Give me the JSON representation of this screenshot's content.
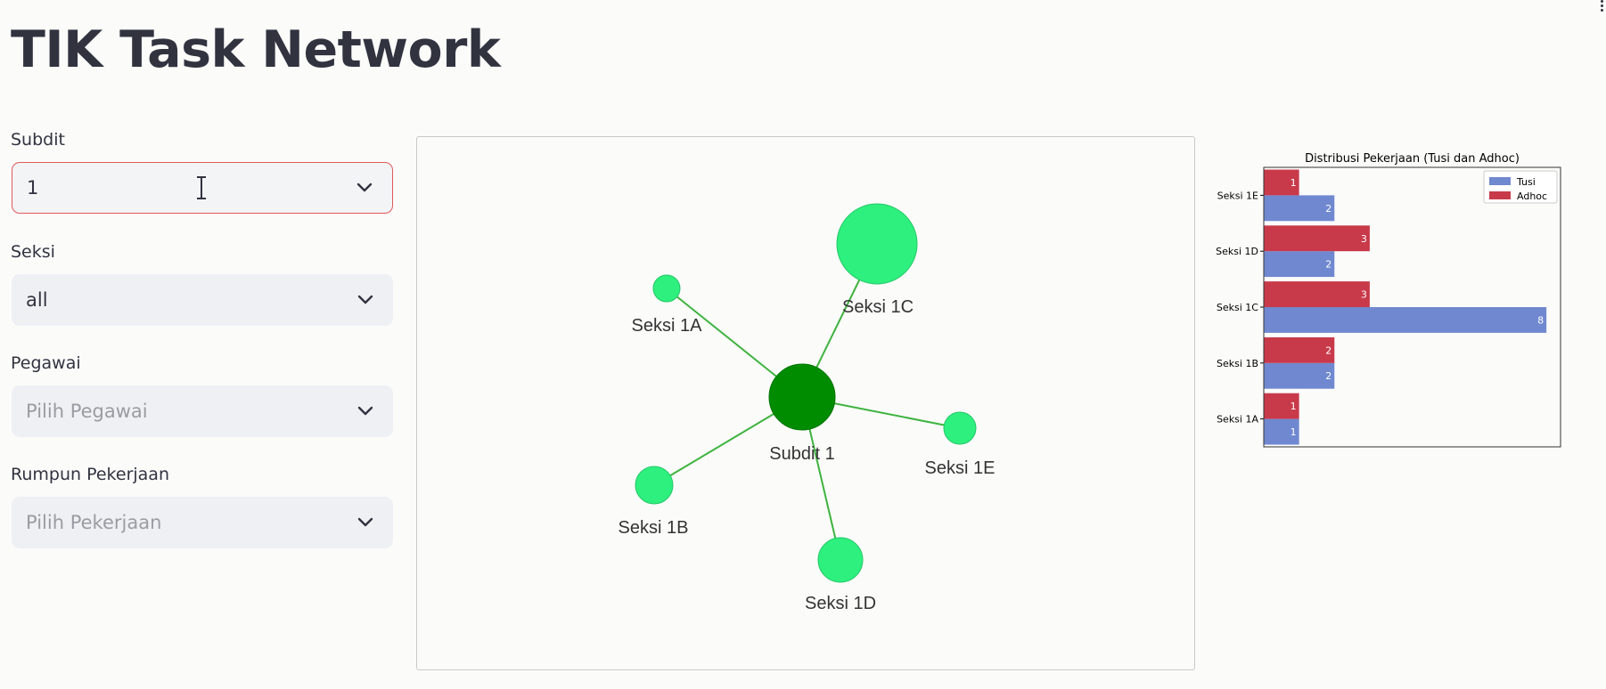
{
  "page": {
    "title": "TIK Task Network"
  },
  "filters": [
    {
      "label": "Subdit",
      "value": "1",
      "placeholder": false
    },
    {
      "label": "Seksi",
      "value": "all",
      "placeholder": false
    },
    {
      "label": "Pegawai",
      "value": "Pilih Pegawai",
      "placeholder": true
    },
    {
      "label": "Rumpun Pekerjaan",
      "value": "Pilih Pekerjaan",
      "placeholder": true
    }
  ],
  "icons": {
    "dropdown": "chevron-down-icon",
    "cursor": "text-cursor-icon",
    "menu": "more-vertical-icon"
  },
  "colors": {
    "center_node": "#008c00",
    "leaf_node": "#2ef07e",
    "edge": "#3fb33f",
    "tusi": "#7088d0",
    "adhoc": "#c83a4a",
    "focus_border": "#e05a5a"
  },
  "network": {
    "center": {
      "label": "Subdit 1"
    },
    "nodes": [
      {
        "label": "Seksi 1A"
      },
      {
        "label": "Seksi 1B"
      },
      {
        "label": "Seksi 1C"
      },
      {
        "label": "Seksi 1D"
      },
      {
        "label": "Seksi 1E"
      }
    ]
  },
  "chart_data": {
    "type": "bar",
    "orientation": "horizontal",
    "title": "Distribusi Pekerjaan (Tusi dan Adhoc)",
    "categories": [
      "Seksi 1A",
      "Seksi 1B",
      "Seksi 1C",
      "Seksi 1D",
      "Seksi 1E"
    ],
    "series": [
      {
        "name": "Tusi",
        "values": [
          1,
          2,
          8,
          2,
          2
        ]
      },
      {
        "name": "Adhoc",
        "values": [
          1,
          2,
          3,
          3,
          1
        ]
      }
    ],
    "xlim": [
      0,
      8.4
    ],
    "legend": "top-right",
    "grid": false
  }
}
